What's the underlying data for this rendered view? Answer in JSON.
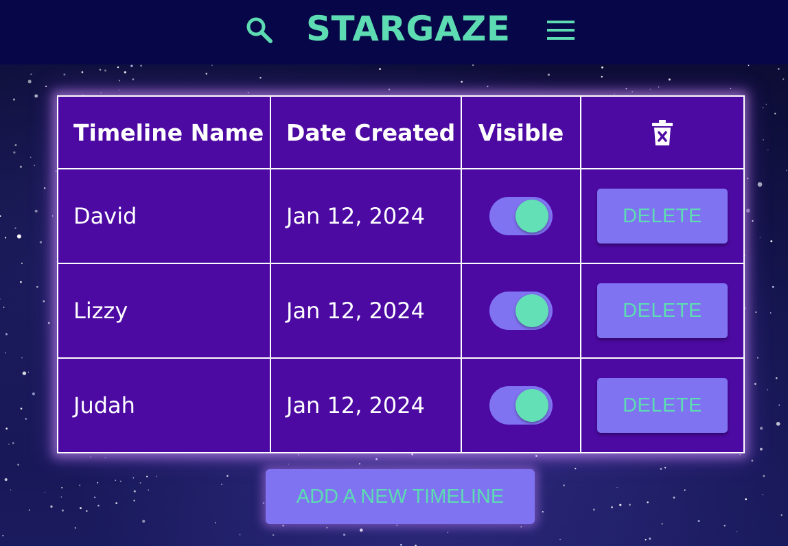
{
  "header": {
    "brand": "STARGAZE",
    "search_icon": "search-icon",
    "menu_icon": "hamburger-menu-icon"
  },
  "table": {
    "columns": [
      "Timeline Name",
      "Date Created",
      "Visible"
    ],
    "trash_icon": "trash-x-icon",
    "rows": [
      {
        "name": "David",
        "date": "Jan 12, 2024",
        "visible": true,
        "delete_label": "DELETE"
      },
      {
        "name": "Lizzy",
        "date": "Jan 12, 2024",
        "visible": true,
        "delete_label": "DELETE"
      },
      {
        "name": "Judah",
        "date": "Jan 12, 2024",
        "visible": true,
        "delete_label": "DELETE"
      }
    ]
  },
  "actions": {
    "add_label": "ADD A NEW TIMELINE"
  },
  "colors": {
    "header_bg": "#070648",
    "accent_green": "#5ddbb2",
    "table_bg": "#4c0aa3",
    "button_bg": "#7f73f2"
  }
}
